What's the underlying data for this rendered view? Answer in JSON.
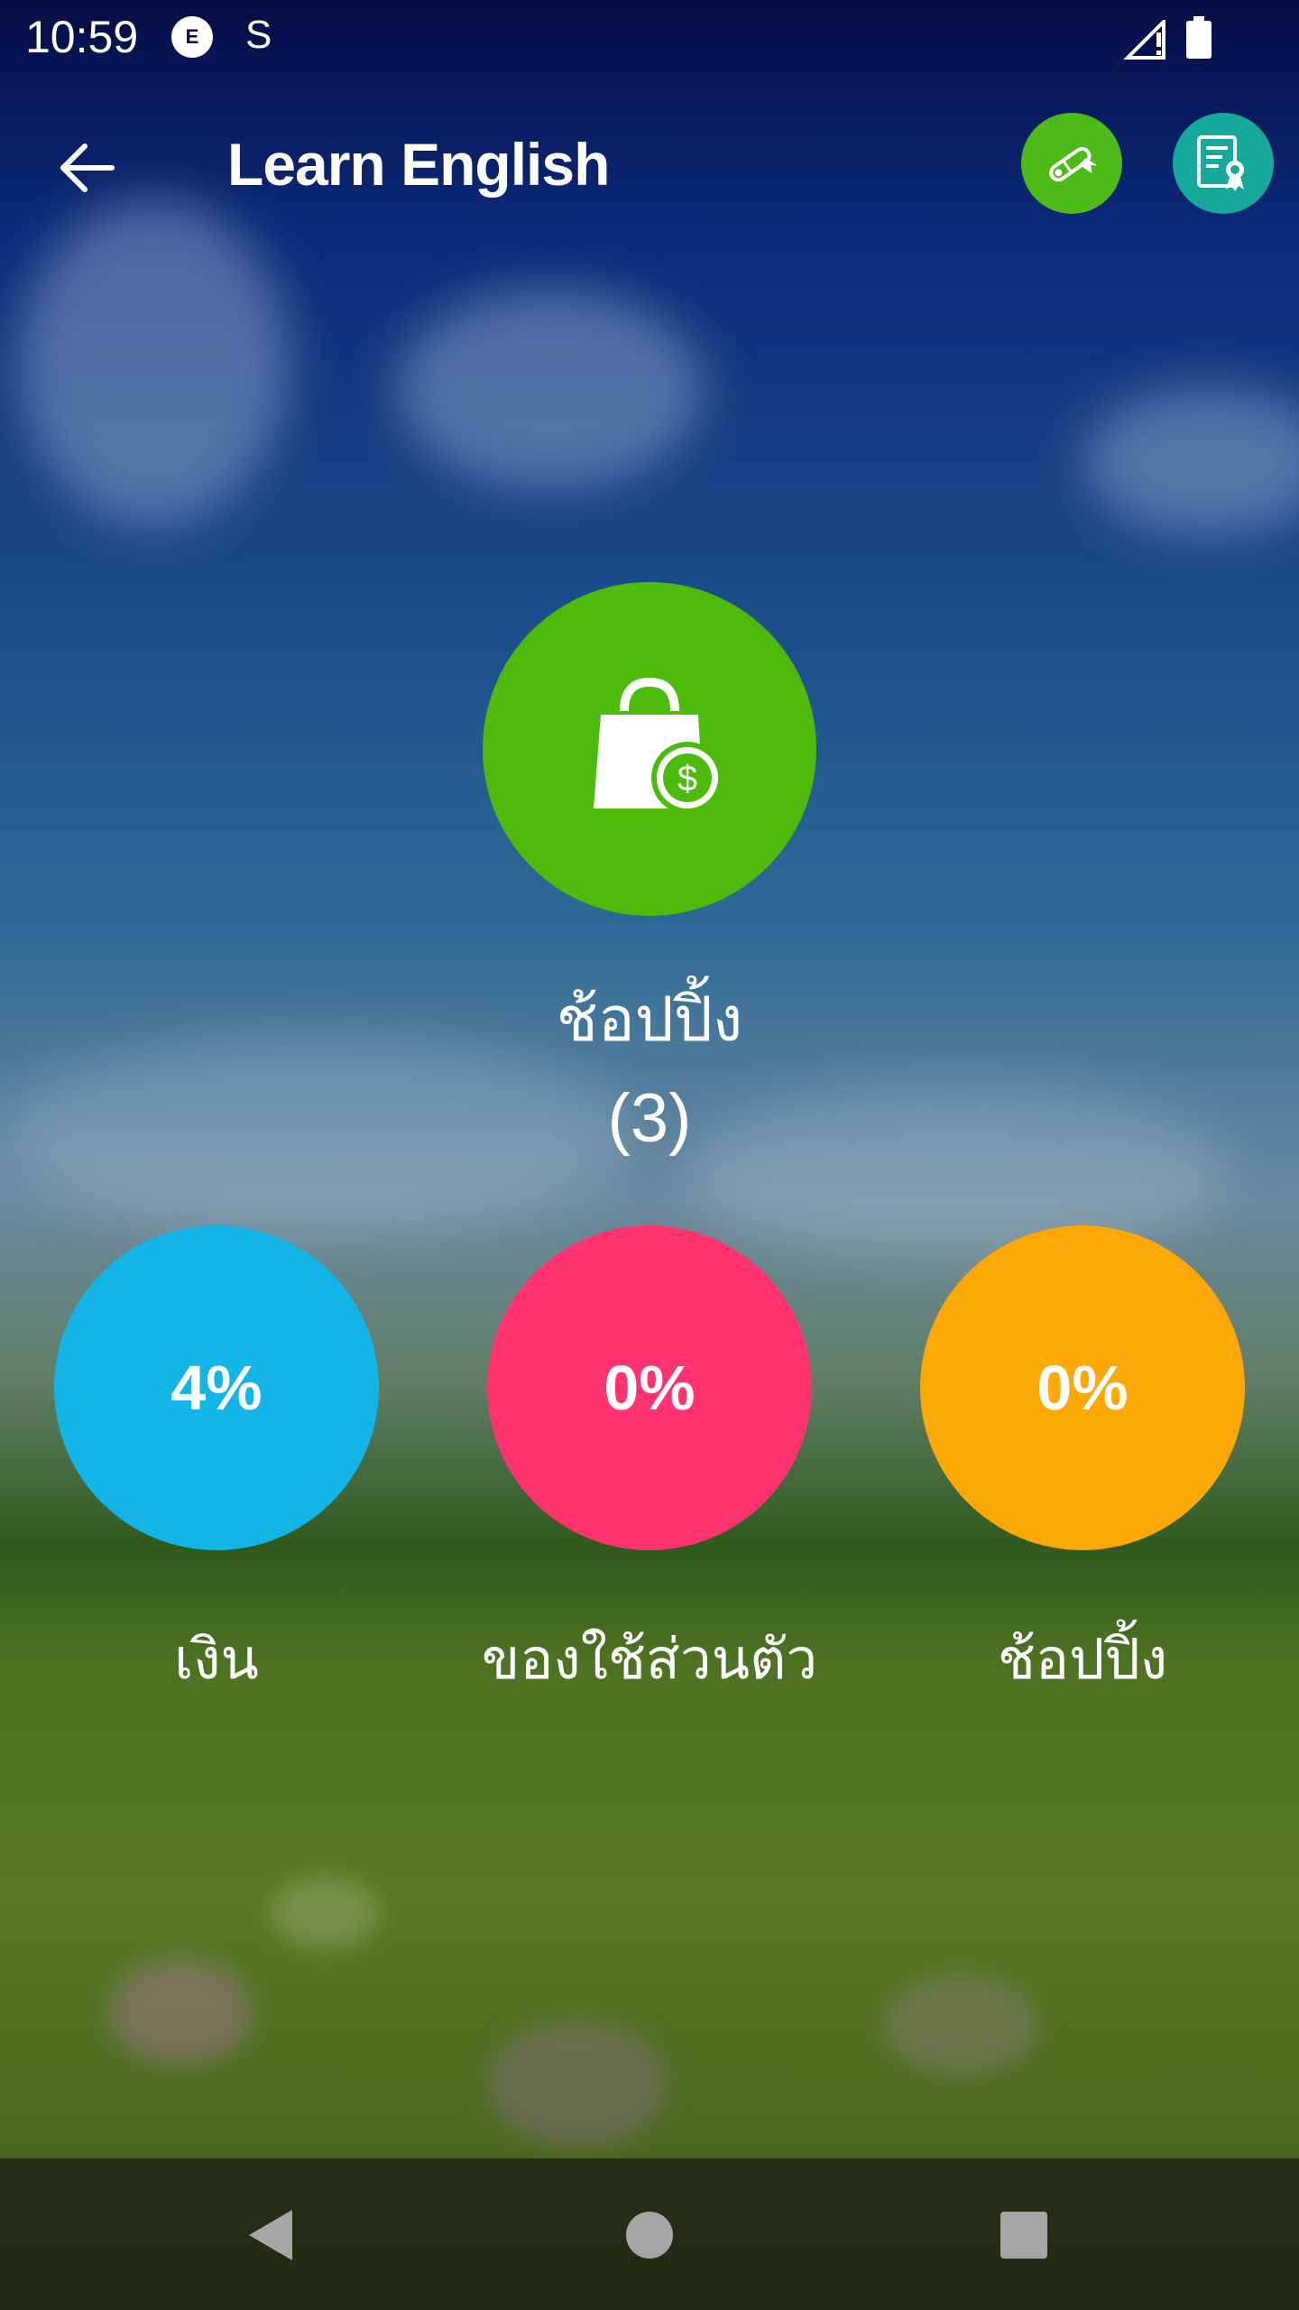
{
  "status_bar": {
    "time": "10:59",
    "notification_icons": [
      "e-chat-icon",
      "s-app-icon"
    ],
    "e_icon_letter": "E",
    "s_icon_letter": "S",
    "signal_icon": "signal-alert-icon",
    "battery_icon": "battery-icon"
  },
  "app_bar": {
    "title": "Learn English",
    "back_icon": "arrow-left-icon",
    "actions": [
      {
        "icon": "diploma-icon",
        "color": "#4cbb17"
      },
      {
        "icon": "certificate-icon",
        "color": "#14a99a"
      }
    ]
  },
  "category": {
    "icon": "shopping-bag-dollar-icon",
    "color": "#4cbb0b",
    "name": "ช้อปปิ้ง",
    "count": "(3)"
  },
  "lessons": [
    {
      "value": "4%",
      "label": "เงิน",
      "color": "#12b5e6"
    },
    {
      "value": "0%",
      "label": "ของใช้ส่วนตัว",
      "color": "#ff3370"
    },
    {
      "value": "0%",
      "label": "ช้อปปิ้ง",
      "color": "#fda805"
    }
  ],
  "nav_bar": {
    "back_icon": "triangle-back-icon",
    "home_icon": "circle-home-icon",
    "recents_icon": "square-recents-icon"
  }
}
